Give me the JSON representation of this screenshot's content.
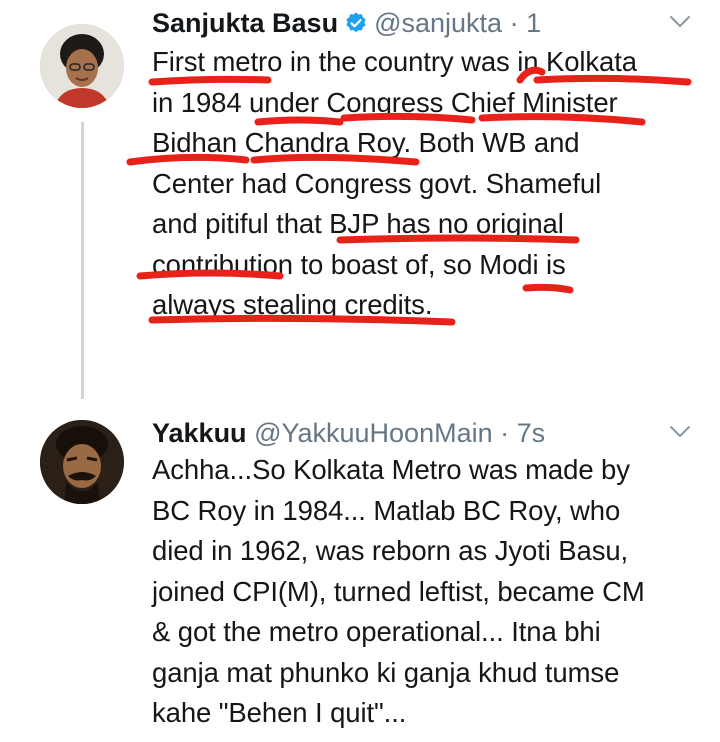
{
  "tweets": [
    {
      "display_name": "Sanjukta Basu",
      "handle": "@sanjukta",
      "separator": "·",
      "time": "1",
      "verified": true,
      "avatar_icon": "user-avatar-photo",
      "text_lines": [
        "First metro in the country was in Kolkata",
        "in 1984 under Congress Chief Minister",
        "Bidhan Chandra Roy. Both WB and",
        "Center had Congress govt. Shameful",
        "and pitiful that BJP has no original",
        "contribution to boast of, so Modi is",
        "always stealing credits."
      ]
    },
    {
      "display_name": "Yakkuu",
      "handle": "@YakkuuHoonMain",
      "separator": "·",
      "time": "7s",
      "verified": false,
      "avatar_icon": "user-avatar-photo",
      "text_lines": [
        "Achha...So Kolkata Metro was made by",
        "BC Roy in 1984... Matlab BC Roy, who",
        "died in 1962, was reborn as Jyoti Basu,",
        "joined CPI(M), turned leftist, became CM",
        "& got the metro operational... Itna bhi",
        "ganja mat phunko ki ganja khud tumse",
        "kahe \"Behen I quit\"..."
      ]
    }
  ],
  "colors": {
    "accent": "#1da1f2",
    "underline": "#e8211b",
    "thread_line": "#ccd6dd",
    "secondary_text": "#657786"
  }
}
